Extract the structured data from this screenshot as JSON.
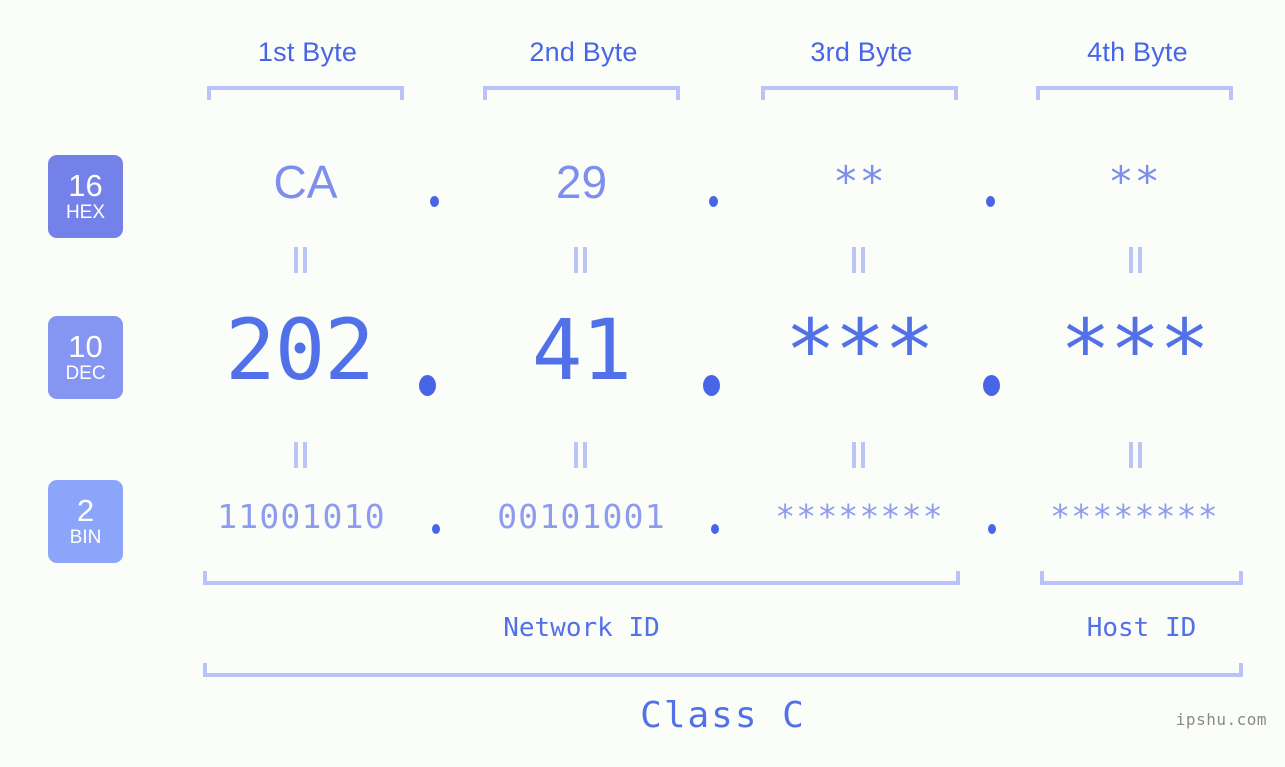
{
  "background_color": "#fbfdf8",
  "accent_colors": {
    "header_blue": "#4865e8",
    "bracket_lavender": "#b9c3f7",
    "hex_value": "#7d8eee",
    "dec_value": "#5271e8",
    "bin_value": "#8e9cf0",
    "badge_hex": "#7381e9",
    "badge_dec": "#8595f2",
    "badge_bin": "#8ba5fa",
    "equals_mark": "#bcc6f6",
    "watermark_gray": "#8a8a8a"
  },
  "byte_headers": [
    {
      "label": "1st Byte"
    },
    {
      "label": "2nd Byte"
    },
    {
      "label": "3rd Byte"
    },
    {
      "label": "4th Byte"
    }
  ],
  "rows": [
    {
      "badge_number": "16",
      "badge_label": "HEX",
      "values": [
        "CA",
        "29",
        "**",
        "**"
      ],
      "separator": "."
    },
    {
      "badge_number": "10",
      "badge_label": "DEC",
      "values": [
        "202",
        "41",
        "***",
        "***"
      ],
      "separator": "."
    },
    {
      "badge_number": "2",
      "badge_label": "BIN",
      "values": [
        "11001010",
        "00101001",
        "********",
        "********"
      ],
      "separator": "."
    }
  ],
  "equals_marks": {
    "hex_to_dec": "=",
    "dec_to_bin": "="
  },
  "segments": {
    "network_id_label": "Network ID",
    "host_id_label": "Host ID",
    "class_label": "Class C"
  },
  "watermark": "ipshu.com"
}
